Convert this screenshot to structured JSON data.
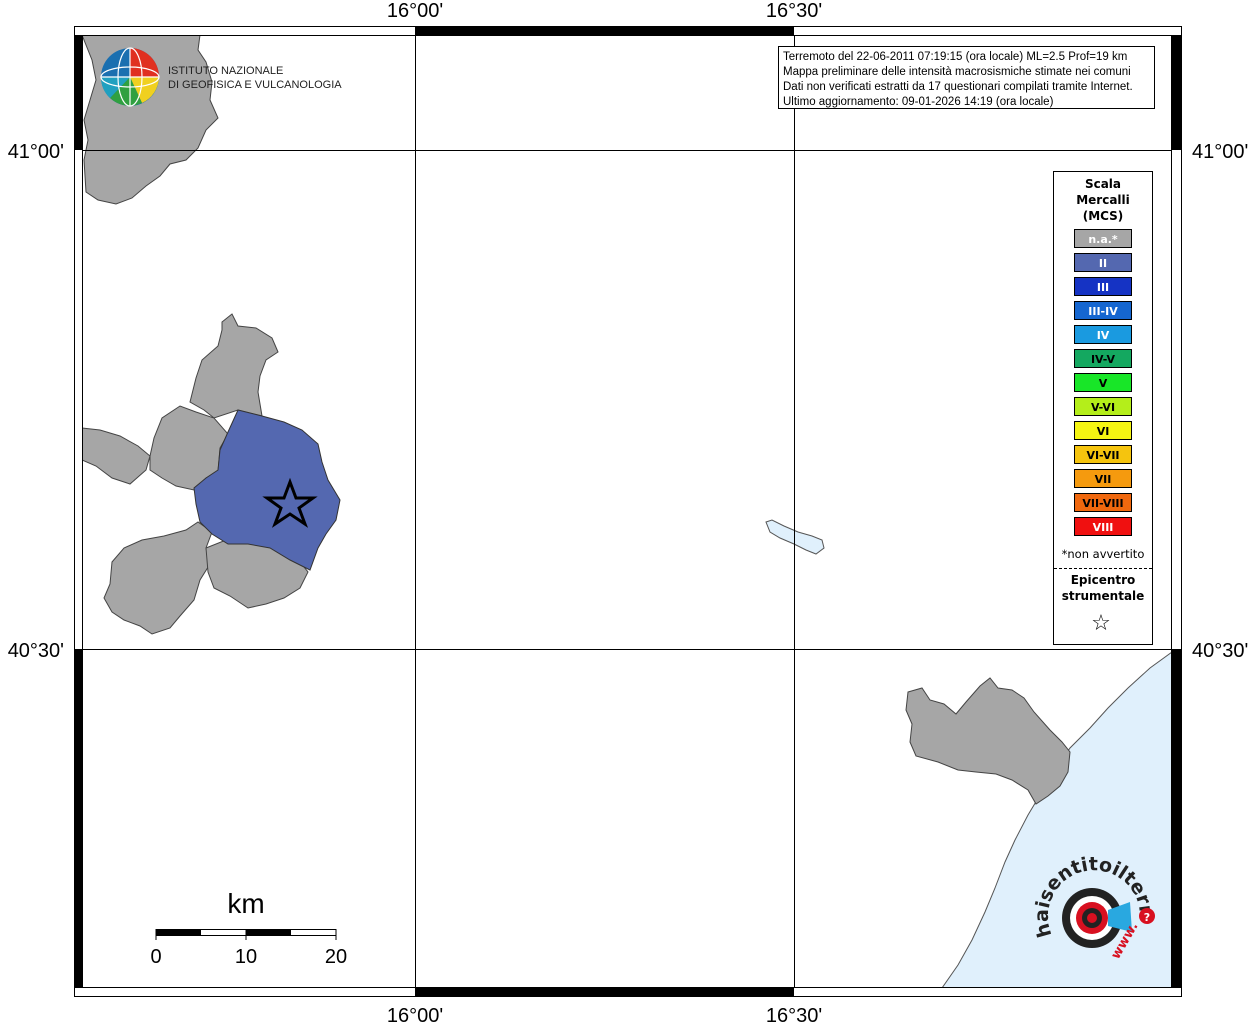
{
  "axes": {
    "top_lon": [
      "16°00'",
      "16°30'"
    ],
    "bottom_lon": [
      "16°00'",
      "16°30'"
    ],
    "left_lat": [
      "41°00'",
      "40°30'"
    ],
    "right_lat": [
      "41°00'",
      "40°30'"
    ]
  },
  "institute": {
    "line1": "ISTITUTO NAZIONALE",
    "line2": "DI GEOFISICA E VULCANOLOGIA"
  },
  "info_box": {
    "line1": "Terremoto del 22-06-2011 07:19:15 (ora locale) ML=2.5 Prof=19 km",
    "line2": "Mappa preliminare delle intensità macrosismiche stimate nei comuni",
    "line3": "Dati non verificati estratti da 17 questionari compilati tramite Internet.",
    "line4": "Ultimo aggiornamento: 09-01-2026 14:19 (ora locale)"
  },
  "legend": {
    "title1": "Scala",
    "title2": "Mercalli",
    "title3": "(MCS)",
    "items": [
      {
        "label": "n.a.*",
        "color": "#a6a6a6",
        "text_color": "#ffffff"
      },
      {
        "label": "II",
        "color": "#5468b0",
        "text_color": "#ffffff"
      },
      {
        "label": "III",
        "color": "#1533c4",
        "text_color": "#ffffff"
      },
      {
        "label": "III-IV",
        "color": "#1566d0",
        "text_color": "#ffffff"
      },
      {
        "label": "IV",
        "color": "#1a9ae0",
        "text_color": "#ffffff"
      },
      {
        "label": "IV-V",
        "color": "#14a860",
        "text_color": "#000000"
      },
      {
        "label": "V",
        "color": "#18e628",
        "text_color": "#000000"
      },
      {
        "label": "V-VI",
        "color": "#b4ee1a",
        "text_color": "#000000"
      },
      {
        "label": "VI",
        "color": "#f5f512",
        "text_color": "#000000"
      },
      {
        "label": "VI-VII",
        "color": "#f5c40e",
        "text_color": "#000000"
      },
      {
        "label": "VII",
        "color": "#f59a0e",
        "text_color": "#000000"
      },
      {
        "label": "VII-VIII",
        "color": "#f0680e",
        "text_color": "#000000"
      },
      {
        "label": "VIII",
        "color": "#f01010",
        "text_color": "#ffffff"
      }
    ],
    "footnote": "*non avvertito",
    "epicenter1": "Epicentro",
    "epicenter2": "strumentale",
    "epicenter_symbol": "☆"
  },
  "scale_bar": {
    "unit": "km",
    "ticks": [
      "0",
      "10",
      "20"
    ]
  },
  "brand": {
    "arc_text": "haisentitoilterremoto.it",
    "www_text": "www."
  },
  "map_colors": {
    "land_gray": "#a6a6a6",
    "intensity_ii": "#5468b0",
    "sea": "#e0f0fc"
  }
}
